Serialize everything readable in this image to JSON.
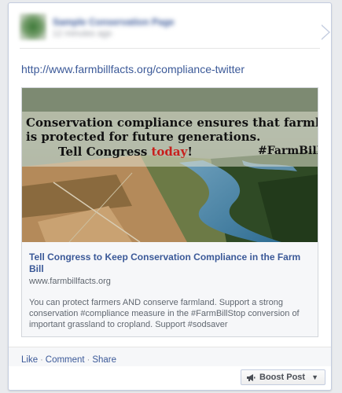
{
  "post": {
    "author_blurred": "Sample Conservation Page",
    "meta_blurred": "12 minutes ago",
    "link_text": "http://www.farmbillfacts.org/compliance-twitter"
  },
  "attachment": {
    "image_text": {
      "line1": "Conservation compliance ensures that farmland",
      "line2": "is protected for future generations.",
      "line3_prefix": "Tell Congress ",
      "line3_highlight": "today",
      "line3_suffix": "!",
      "hashtag": "#FarmBill"
    },
    "title": "Tell Congress to Keep Conservation Compliance in the Farm Bill",
    "domain": "www.farmbillfacts.org",
    "description": "You can protect farmers AND conserve farmland. Support a strong conservation #compliance measure in the #FarmBillStop conversion of important grassland to cropland. Support #sodsaver"
  },
  "actions": {
    "like": "Like",
    "comment": "Comment",
    "share": "Share",
    "separator": "·"
  },
  "boost": {
    "label": "Boost Post",
    "icon": "megaphone-icon"
  },
  "colors": {
    "link": "#3b5998",
    "highlight_red": "#c8201c"
  }
}
